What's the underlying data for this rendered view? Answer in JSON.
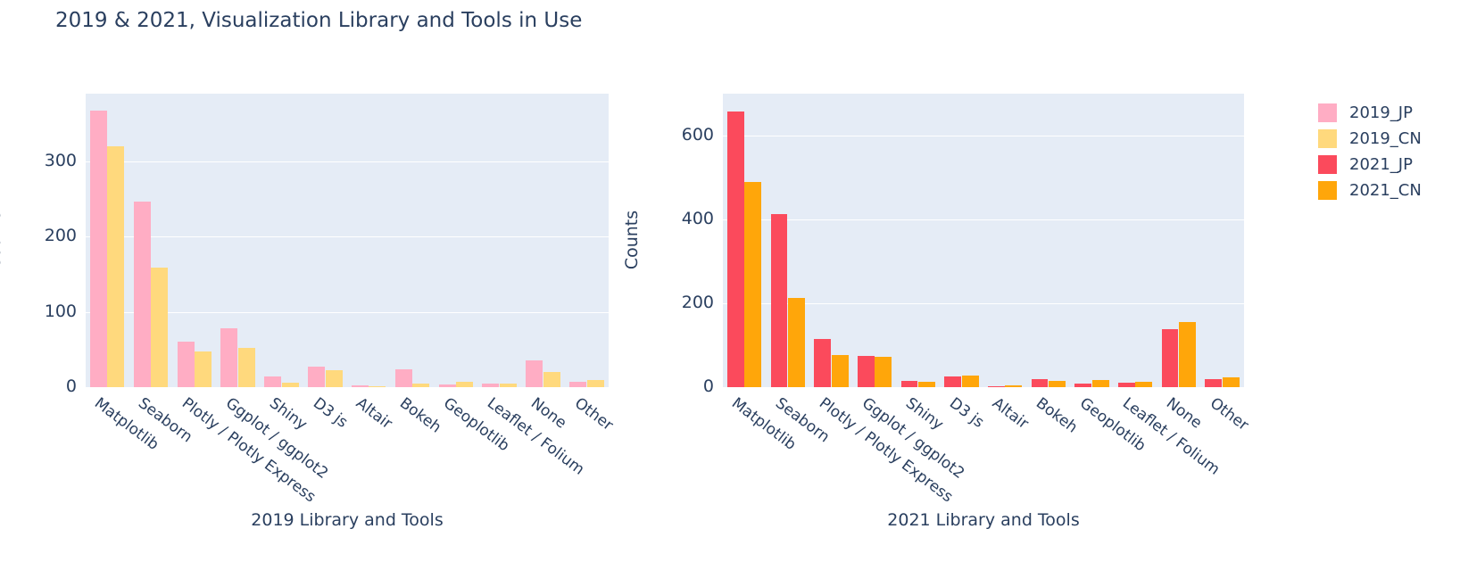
{
  "chart_data": {
    "type": "bar",
    "title": "2019 & 2021, Visualization Library and Tools in Use",
    "categories": [
      "Matplotlib",
      "Seaborn",
      "Plotly / Plotly Express",
      "Ggplot / ggplot2",
      "Shiny",
      "D3 js",
      "Altair",
      "Bokeh",
      "Geoplotlib",
      "Leaflet / Folium",
      "None",
      "Other"
    ],
    "panels": [
      {
        "name": "2019",
        "xlabel": "2019 Library and Tools",
        "ylabel": "Counts",
        "ylim": [
          0,
          390
        ],
        "yticks": [
          0,
          100,
          200,
          300
        ],
        "grid": true,
        "series": [
          {
            "name": "2019_JP",
            "color": "#FFADC4",
            "values": [
              368,
              247,
              60,
              78,
              14,
              27,
              2,
              24,
              4,
              5,
              35,
              7
            ]
          },
          {
            "name": "2019_CN",
            "color": "#FFD97D",
            "values": [
              320,
              159,
              48,
              52,
              6,
              22,
              1,
              5,
              7,
              5,
              20,
              10
            ]
          }
        ]
      },
      {
        "name": "2021",
        "xlabel": "2021 Library and Tools",
        "ylabel": "Counts",
        "ylim": [
          0,
          700
        ],
        "yticks": [
          0,
          200,
          400,
          600
        ],
        "grid": true,
        "series": [
          {
            "name": "2021_JP",
            "color": "#FB4A5C",
            "values": [
              657,
              412,
              114,
              75,
              15,
              26,
              3,
              20,
              8,
              11,
              138,
              19
            ]
          },
          {
            "name": "2021_CN",
            "color": "#FFA60A",
            "values": [
              490,
              212,
              76,
              73,
              13,
              27,
              4,
              14,
              16,
              13,
              155,
              24
            ]
          }
        ]
      }
    ],
    "legend": {
      "position": "right",
      "entries": [
        {
          "label": "2019_JP",
          "color": "#FFADC4"
        },
        {
          "label": "2019_CN",
          "color": "#FFD97D"
        },
        {
          "label": "2021_JP",
          "color": "#FB4A5C"
        },
        {
          "label": "2021_CN",
          "color": "#FFA60A"
        }
      ]
    },
    "style": {
      "plot_bg": "#e5ecf6",
      "paper_bg": "#ffffff",
      "text_color": "#2a3f5f",
      "gridline_color": "#ffffff"
    }
  }
}
